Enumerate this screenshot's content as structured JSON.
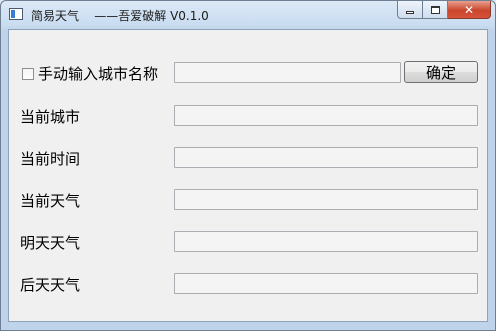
{
  "window": {
    "title": "简易天气    ——吾爱破解 V0.1.0"
  },
  "caption": {
    "close_glyph": "✕"
  },
  "form": {
    "manual_city_label": "手动输入城市名称",
    "manual_city_checked": false,
    "city_input_value": "",
    "confirm_button": "确定",
    "rows": [
      {
        "label": "当前城市",
        "value": ""
      },
      {
        "label": "当前时间",
        "value": ""
      },
      {
        "label": "当前天气",
        "value": ""
      },
      {
        "label": "明天天气",
        "value": ""
      },
      {
        "label": "后天天气",
        "value": ""
      }
    ]
  }
}
